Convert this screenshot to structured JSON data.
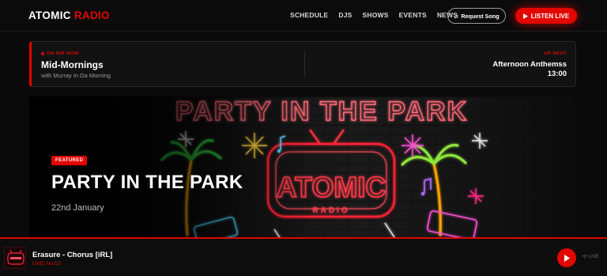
{
  "brand": {
    "logo_white": "ATOMIC",
    "logo_red": "RADIO"
  },
  "nav": {
    "items": [
      "SCHEDULE",
      "DJS",
      "SHOWS",
      "EVENTS",
      "NEWS"
    ]
  },
  "header": {
    "request_label": "Request Song",
    "listen_label": "LISTEN LIVE"
  },
  "on_air": {
    "tag": "ON AIR NOW",
    "show": "Mid-Mornings",
    "host": "with Murray In Da Morning",
    "next_tag": "UP NEXT",
    "next_show": "Afternoon Anthemss",
    "next_time": "13:00"
  },
  "hero": {
    "badge": "FEATURED",
    "title": "PARTY IN THE PARK",
    "date": "22nd January",
    "neon_heading": "PARTY IN THE PARK",
    "neon_logo_main": "ATOMIC",
    "neon_logo_sub": "RADIO"
  },
  "player": {
    "track": "Erasure - Chorus [iRL]",
    "status": "LIVE: No DJ",
    "live_label": "LIVE"
  },
  "colors": {
    "accent": "#e10600",
    "background": "#0a0a0a"
  },
  "icons": {
    "request": "music-note-icon",
    "listen": "play-icon",
    "player_play": "play-icon",
    "live": "signal-icon"
  }
}
